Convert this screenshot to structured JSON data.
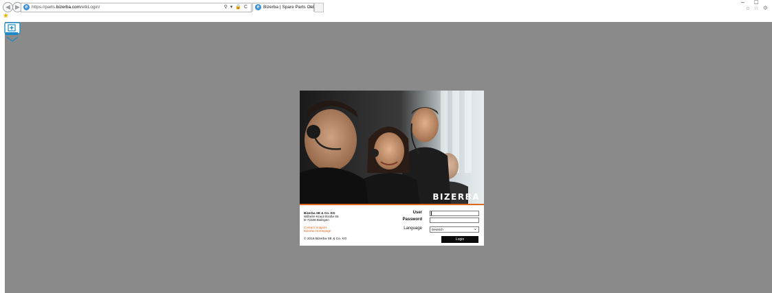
{
  "browser": {
    "back_icon": "back-arrow-icon",
    "forward_icon": "forward-arrow-icon",
    "url_prefix": "https://parts.",
    "url_domain": "bizerba.com",
    "url_path": "/etkLogin/",
    "address_controls": "⚲ ▾ 🔒 C",
    "tab_title": "Bizerba | Spare Parts Catalog",
    "tab_close": "×",
    "window_controls": "– □",
    "toolbar_icons": "⌂ ☆ ⚙",
    "favorites_icon": "★"
  },
  "page": {
    "zoom_widget_icon": "zoom-in-icon",
    "colors": {
      "background": "#8a8a8a",
      "accent": "#e0671f"
    }
  },
  "login": {
    "brand": "BIZERBA",
    "company": "Bizerba SE & Co. KG",
    "street": "Wilhelm-Kraut-Straße 65",
    "city": "D-72336 Balingen",
    "contact_support": "Contact Support",
    "homepage": "Bizerba Homepage",
    "copyright": "© 2016 Bizerba SE & Co. KG",
    "user_label": "User",
    "password_label": "Password",
    "language_label": "Language",
    "language_value": "Deutsch",
    "user_value": "",
    "password_value": "",
    "login_button": "Login"
  }
}
